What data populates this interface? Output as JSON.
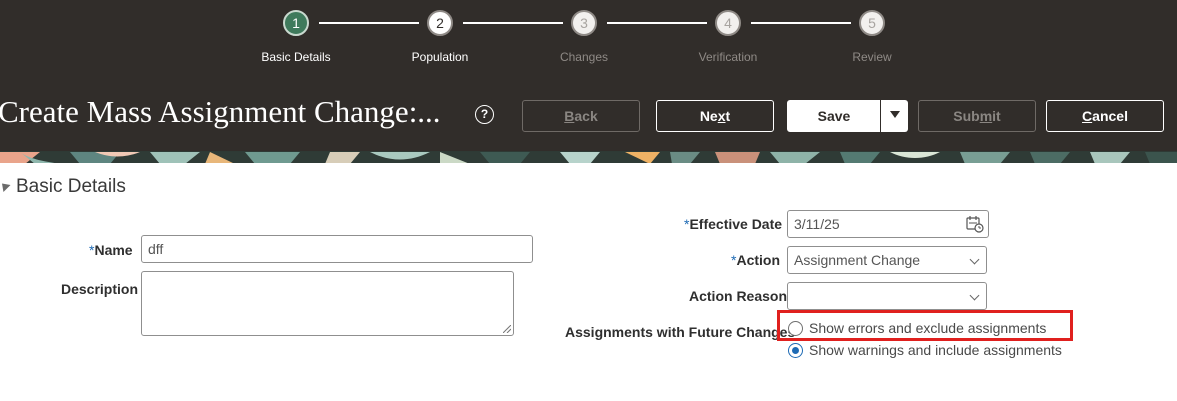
{
  "train": {
    "steps": [
      {
        "number": "1",
        "label": "Basic Details",
        "state": "done"
      },
      {
        "number": "2",
        "label": "Population",
        "state": "current"
      },
      {
        "number": "3",
        "label": "Changes",
        "state": "future"
      },
      {
        "number": "4",
        "label": "Verification",
        "state": "future"
      },
      {
        "number": "5",
        "label": "Review",
        "state": "future"
      }
    ]
  },
  "header": {
    "title": "Create Mass Assignment Change:...",
    "help_icon": "question-circle-icon",
    "buttons": {
      "back": {
        "pre": "",
        "accel": "B",
        "post": "ack"
      },
      "next": {
        "pre": "Ne",
        "accel": "x",
        "post": "t"
      },
      "save": "Save",
      "submit": {
        "pre": "Sub",
        "accel": "m",
        "post": "it"
      },
      "cancel": {
        "pre": "",
        "accel": "C",
        "post": "ancel"
      }
    }
  },
  "section": {
    "title": "Basic Details"
  },
  "form": {
    "name": {
      "required": "*",
      "label": "Name",
      "value": "dff"
    },
    "description": {
      "label": "Description",
      "value": ""
    },
    "effective_date": {
      "required": "*",
      "label": "Effective Date",
      "value": "3/11/25"
    },
    "action": {
      "required": "*",
      "label": "Action",
      "value": "Assignment Change"
    },
    "action_reason": {
      "label": "Action Reason",
      "value": ""
    },
    "future_changes": {
      "label": "Assignments with Future Changes",
      "options": [
        {
          "label": "Show errors and exclude assignments",
          "selected": false
        },
        {
          "label": "Show warnings and include assignments",
          "selected": true
        }
      ]
    }
  },
  "colors": {
    "header_bg": "#312d2a",
    "step_done": "#3f7a5c",
    "radio_accent": "#1e6ab4",
    "highlight": "#e0201e"
  }
}
